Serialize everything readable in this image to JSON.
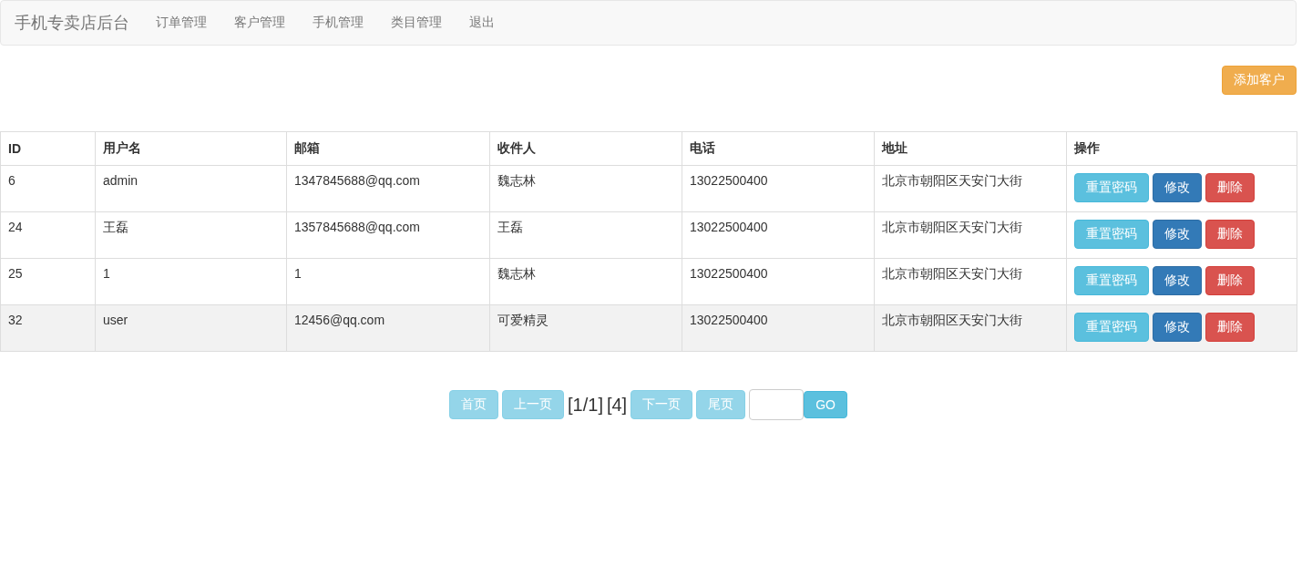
{
  "navbar": {
    "brand": "手机专卖店后台",
    "links": [
      "订单管理",
      "客户管理",
      "手机管理",
      "类目管理",
      "退出"
    ]
  },
  "add_button": "添加客户",
  "table": {
    "columns": [
      "ID",
      "用户名",
      "邮箱",
      "收件人",
      "电话",
      "地址",
      "操作"
    ],
    "rows": [
      {
        "cells": [
          "6",
          "admin",
          "1347845688@qq.com",
          "魏志林",
          "13022500400",
          "北京市朝阳区天安门大街"
        ],
        "highlighted": false,
        "actions": [
          {
            "label": "重置密码",
            "kind": "info"
          },
          {
            "label": "修改",
            "kind": "primary"
          },
          {
            "label": "删除",
            "kind": "danger"
          }
        ]
      },
      {
        "cells": [
          "24",
          "王磊",
          "1357845688@qq.com",
          "王磊",
          "13022500400",
          "北京市朝阳区天安门大街"
        ],
        "highlighted": false,
        "actions": [
          {
            "label": "重置密码",
            "kind": "info"
          },
          {
            "label": "修改",
            "kind": "primary"
          },
          {
            "label": "删除",
            "kind": "danger"
          }
        ]
      },
      {
        "cells": [
          "25",
          "1",
          "1",
          "魏志林",
          "13022500400",
          "北京市朝阳区天安门大街"
        ],
        "highlighted": false,
        "actions": [
          {
            "label": "重置密码",
            "kind": "info"
          },
          {
            "label": "修改",
            "kind": "primary"
          },
          {
            "label": "删除",
            "kind": "danger"
          }
        ]
      },
      {
        "cells": [
          "32",
          "user",
          "12456@qq.com",
          "可爱精灵",
          "13022500400",
          "北京市朝阳区天安门大街"
        ],
        "highlighted": true,
        "actions": [
          {
            "label": "重置密码",
            "kind": "info"
          },
          {
            "label": "修改",
            "kind": "primary"
          },
          {
            "label": "删除",
            "kind": "danger"
          }
        ]
      }
    ]
  },
  "pagination": {
    "first": {
      "label": "首页",
      "disabled": true
    },
    "prev": {
      "label": "上一页",
      "disabled": true
    },
    "page_info": "[1/1]",
    "total": "[4]",
    "next": {
      "label": "下一页",
      "disabled": true
    },
    "last": {
      "label": "尾页",
      "disabled": true
    },
    "go": {
      "label": "GO",
      "disabled": false
    }
  }
}
